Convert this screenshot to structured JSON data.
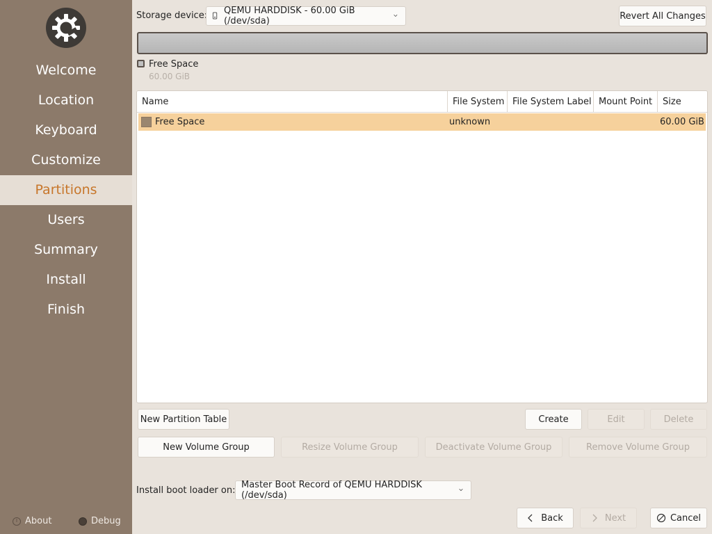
{
  "sidebar": {
    "items": [
      {
        "label": "Welcome"
      },
      {
        "label": "Location"
      },
      {
        "label": "Keyboard"
      },
      {
        "label": "Customize"
      },
      {
        "label": "Partitions",
        "active": true
      },
      {
        "label": "Users"
      },
      {
        "label": "Summary"
      },
      {
        "label": "Install"
      },
      {
        "label": "Finish"
      }
    ],
    "about_label": "About",
    "debug_label": "Debug"
  },
  "storage": {
    "label": "Storage device:",
    "device": "QEMU HARDDISK - 60.00 GiB (/dev/sda)",
    "revert_label": "Revert All Changes"
  },
  "legend": {
    "name": "Free Space",
    "size": "60.00 GiB"
  },
  "table": {
    "headers": [
      "Name",
      "File System",
      "File System Label",
      "Mount Point",
      "Size"
    ],
    "rows": [
      {
        "name": "Free Space",
        "filesystem": "unknown",
        "fs_label": "",
        "mount": "",
        "size": "60.00 GiB"
      }
    ]
  },
  "actions": {
    "new_partition_table": "New Partition Table",
    "create": "Create",
    "edit": "Edit",
    "delete": "Delete",
    "new_volume_group": "New Volume Group",
    "resize_volume_group": "Resize Volume Group",
    "deactivate_volume_group": "Deactivate Volume Group",
    "remove_volume_group": "Remove Volume Group"
  },
  "bootloader": {
    "label": "Install boot loader on:",
    "value": "Master Boot Record of QEMU HARDDISK (/dev/sda)"
  },
  "nav": {
    "back": "Back",
    "next": "Next",
    "cancel": "Cancel"
  },
  "colors": {
    "sidebar_bg": "#8c7a6a",
    "accent": "#c7762a",
    "selected_row": "#f6d19c"
  }
}
